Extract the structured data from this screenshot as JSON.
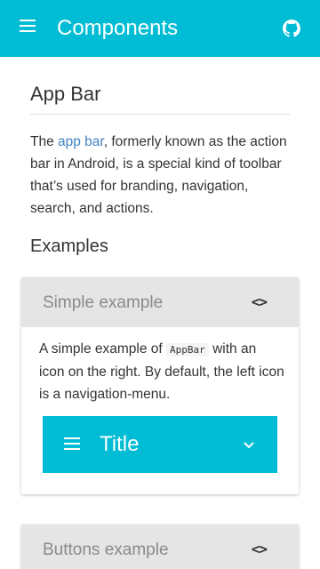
{
  "app_bar": {
    "title": "Components",
    "menu_icon": "hamburger-menu-icon",
    "github_icon": "github-icon"
  },
  "page": {
    "title": "App Bar",
    "intro_before_link": "The ",
    "intro_link": "app bar",
    "intro_after_link": ", formerly known as the action bar in Android, is a special kind of toolbar that’s used for branding, navigation, search, and actions.",
    "examples_heading": "Examples"
  },
  "cards": [
    {
      "title": "Simple example",
      "code_toggle": "<>",
      "text_before_code": "A simple example of ",
      "code": "AppBar",
      "text_after_code": " with an icon on the right. By default, the left icon is a navigation-menu.",
      "demo": {
        "title": "Title",
        "menu_icon": "hamburger-menu-icon",
        "right_icon": "chevron-down-icon"
      }
    },
    {
      "title": "Buttons example",
      "code_toggle": "<>"
    }
  ],
  "colors": {
    "primary": "#00bcd4",
    "link": "#4183c4",
    "card_header": "#e5e5e5"
  }
}
